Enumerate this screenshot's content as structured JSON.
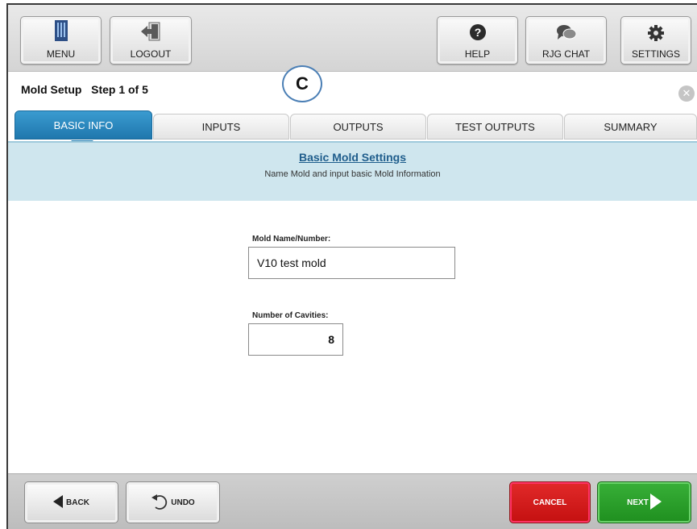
{
  "toolbar": {
    "menu_label": "MENU",
    "logout_label": "LOGOUT",
    "help_label": "HELP",
    "chat_label": "RJG CHAT",
    "settings_label": "SETTINGS"
  },
  "header": {
    "title": "Mold Setup   Step 1 of 5",
    "callout": "C"
  },
  "tabs": [
    {
      "label": "BASIC INFO",
      "active": true
    },
    {
      "label": "INPUTS",
      "active": false
    },
    {
      "label": "OUTPUTS",
      "active": false
    },
    {
      "label": "TEST OUTPUTS",
      "active": false
    },
    {
      "label": "SUMMARY",
      "active": false
    }
  ],
  "section": {
    "heading": "Basic Mold Settings",
    "subheading": "Name Mold and input basic Mold Information"
  },
  "form": {
    "mold_name_label": "Mold Name/Number:",
    "mold_name_value": "V10 test mold",
    "cavities_label": "Number of Cavities:",
    "cavities_value": "8"
  },
  "footer": {
    "back_label": "BACK",
    "undo_label": "UNDO",
    "cancel_label": "CANCEL",
    "next_label": "NEXT"
  },
  "colors": {
    "active_tab": "#2580b5",
    "banner": "#cfe6ee",
    "cancel": "#d41b1b",
    "next": "#2a9f2a"
  },
  "icons": [
    "menu-icon",
    "logout-icon",
    "help-icon",
    "chat-icon",
    "gear-icon",
    "close-icon",
    "back-arrow-icon",
    "undo-icon",
    "next-arrow-icon"
  ]
}
